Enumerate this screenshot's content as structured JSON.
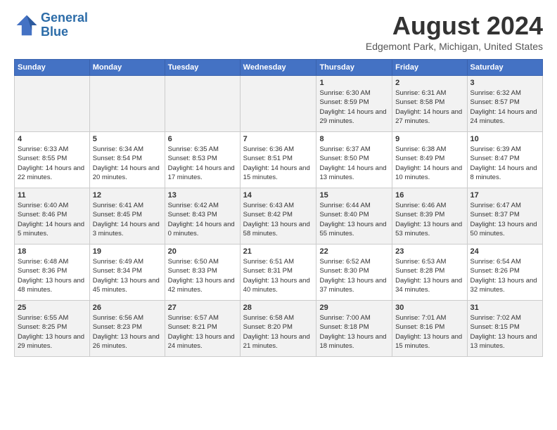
{
  "header": {
    "logo_line1": "General",
    "logo_line2": "Blue",
    "title": "August 2024",
    "location": "Edgemont Park, Michigan, United States"
  },
  "days_of_week": [
    "Sunday",
    "Monday",
    "Tuesday",
    "Wednesday",
    "Thursday",
    "Friday",
    "Saturday"
  ],
  "weeks": [
    [
      {
        "day": "",
        "info": ""
      },
      {
        "day": "",
        "info": ""
      },
      {
        "day": "",
        "info": ""
      },
      {
        "day": "",
        "info": ""
      },
      {
        "day": "1",
        "info": "Sunrise: 6:30 AM\nSunset: 8:59 PM\nDaylight: 14 hours and 29 minutes."
      },
      {
        "day": "2",
        "info": "Sunrise: 6:31 AM\nSunset: 8:58 PM\nDaylight: 14 hours and 27 minutes."
      },
      {
        "day": "3",
        "info": "Sunrise: 6:32 AM\nSunset: 8:57 PM\nDaylight: 14 hours and 24 minutes."
      }
    ],
    [
      {
        "day": "4",
        "info": "Sunrise: 6:33 AM\nSunset: 8:55 PM\nDaylight: 14 hours and 22 minutes."
      },
      {
        "day": "5",
        "info": "Sunrise: 6:34 AM\nSunset: 8:54 PM\nDaylight: 14 hours and 20 minutes."
      },
      {
        "day": "6",
        "info": "Sunrise: 6:35 AM\nSunset: 8:53 PM\nDaylight: 14 hours and 17 minutes."
      },
      {
        "day": "7",
        "info": "Sunrise: 6:36 AM\nSunset: 8:51 PM\nDaylight: 14 hours and 15 minutes."
      },
      {
        "day": "8",
        "info": "Sunrise: 6:37 AM\nSunset: 8:50 PM\nDaylight: 14 hours and 13 minutes."
      },
      {
        "day": "9",
        "info": "Sunrise: 6:38 AM\nSunset: 8:49 PM\nDaylight: 14 hours and 10 minutes."
      },
      {
        "day": "10",
        "info": "Sunrise: 6:39 AM\nSunset: 8:47 PM\nDaylight: 14 hours and 8 minutes."
      }
    ],
    [
      {
        "day": "11",
        "info": "Sunrise: 6:40 AM\nSunset: 8:46 PM\nDaylight: 14 hours and 5 minutes."
      },
      {
        "day": "12",
        "info": "Sunrise: 6:41 AM\nSunset: 8:45 PM\nDaylight: 14 hours and 3 minutes."
      },
      {
        "day": "13",
        "info": "Sunrise: 6:42 AM\nSunset: 8:43 PM\nDaylight: 14 hours and 0 minutes."
      },
      {
        "day": "14",
        "info": "Sunrise: 6:43 AM\nSunset: 8:42 PM\nDaylight: 13 hours and 58 minutes."
      },
      {
        "day": "15",
        "info": "Sunrise: 6:44 AM\nSunset: 8:40 PM\nDaylight: 13 hours and 55 minutes."
      },
      {
        "day": "16",
        "info": "Sunrise: 6:46 AM\nSunset: 8:39 PM\nDaylight: 13 hours and 53 minutes."
      },
      {
        "day": "17",
        "info": "Sunrise: 6:47 AM\nSunset: 8:37 PM\nDaylight: 13 hours and 50 minutes."
      }
    ],
    [
      {
        "day": "18",
        "info": "Sunrise: 6:48 AM\nSunset: 8:36 PM\nDaylight: 13 hours and 48 minutes."
      },
      {
        "day": "19",
        "info": "Sunrise: 6:49 AM\nSunset: 8:34 PM\nDaylight: 13 hours and 45 minutes."
      },
      {
        "day": "20",
        "info": "Sunrise: 6:50 AM\nSunset: 8:33 PM\nDaylight: 13 hours and 42 minutes."
      },
      {
        "day": "21",
        "info": "Sunrise: 6:51 AM\nSunset: 8:31 PM\nDaylight: 13 hours and 40 minutes."
      },
      {
        "day": "22",
        "info": "Sunrise: 6:52 AM\nSunset: 8:30 PM\nDaylight: 13 hours and 37 minutes."
      },
      {
        "day": "23",
        "info": "Sunrise: 6:53 AM\nSunset: 8:28 PM\nDaylight: 13 hours and 34 minutes."
      },
      {
        "day": "24",
        "info": "Sunrise: 6:54 AM\nSunset: 8:26 PM\nDaylight: 13 hours and 32 minutes."
      }
    ],
    [
      {
        "day": "25",
        "info": "Sunrise: 6:55 AM\nSunset: 8:25 PM\nDaylight: 13 hours and 29 minutes."
      },
      {
        "day": "26",
        "info": "Sunrise: 6:56 AM\nSunset: 8:23 PM\nDaylight: 13 hours and 26 minutes."
      },
      {
        "day": "27",
        "info": "Sunrise: 6:57 AM\nSunset: 8:21 PM\nDaylight: 13 hours and 24 minutes."
      },
      {
        "day": "28",
        "info": "Sunrise: 6:58 AM\nSunset: 8:20 PM\nDaylight: 13 hours and 21 minutes."
      },
      {
        "day": "29",
        "info": "Sunrise: 7:00 AM\nSunset: 8:18 PM\nDaylight: 13 hours and 18 minutes."
      },
      {
        "day": "30",
        "info": "Sunrise: 7:01 AM\nSunset: 8:16 PM\nDaylight: 13 hours and 15 minutes."
      },
      {
        "day": "31",
        "info": "Sunrise: 7:02 AM\nSunset: 8:15 PM\nDaylight: 13 hours and 13 minutes."
      }
    ]
  ]
}
